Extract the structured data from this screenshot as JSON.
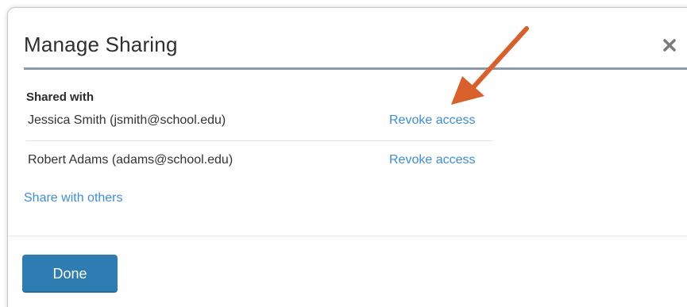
{
  "dialog": {
    "title": "Manage Sharing",
    "close_icon": "close-icon"
  },
  "shared_with": {
    "label": "Shared with",
    "people": [
      {
        "name": "Jessica Smith (jsmith@school.edu)",
        "action": "Revoke access"
      },
      {
        "name": "Robert Adams (adams@school.edu)",
        "action": "Revoke access"
      }
    ]
  },
  "share_with_others": "Share with others",
  "footer": {
    "done_label": "Done"
  },
  "colors": {
    "accent_link": "#3e8ddd",
    "primary_button": "#2d7db3",
    "header_rule": "#8a99ab",
    "annotation_arrow": "#d95f2b"
  }
}
